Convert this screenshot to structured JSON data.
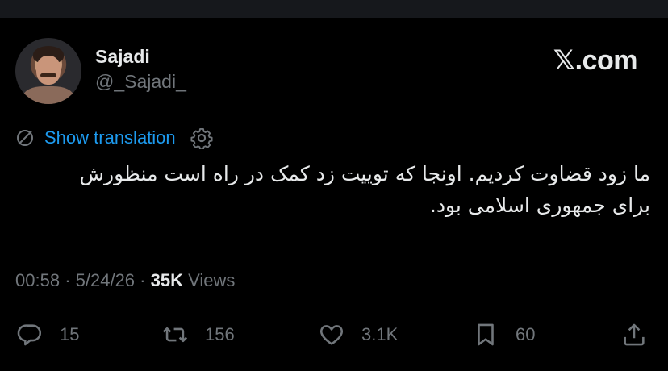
{
  "author": {
    "name": "Sajadi",
    "handle": "@_Sajadi_"
  },
  "brand": "𝕏.com",
  "translation": {
    "label": "Show translation"
  },
  "tweet": {
    "text": "ما زود قضاوت کردیم. اونجا که توییت زد کمک در راه است منظورش برای جمهوری اسلامی بود."
  },
  "meta": {
    "time": "00:58",
    "date": "5/24/26",
    "views_count": "35K",
    "views_label": "Views"
  },
  "actions": {
    "replies": "15",
    "reposts": "156",
    "likes": "3.1K",
    "bookmarks": "60"
  },
  "colors": {
    "background": "#000000",
    "text": "#e7e9ea",
    "secondary": "#71767b",
    "accent": "#1d9bf0"
  }
}
